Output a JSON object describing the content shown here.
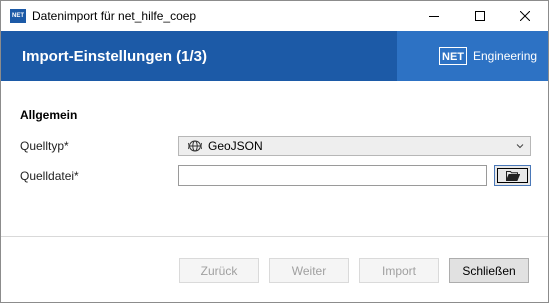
{
  "window": {
    "title": "Datenimport für net_hilfe_coep",
    "app_icon_text": "NET"
  },
  "header": {
    "title": "Import-Einstellungen (1/3)",
    "logo_mark": "NET",
    "logo_text": "Engineering"
  },
  "form": {
    "section_title": "Allgemein",
    "source_type": {
      "label": "Quelltyp*",
      "value": "GeoJSON",
      "icon": "globe-icon"
    },
    "source_file": {
      "label": "Quelldatei*",
      "value": "",
      "browse_icon": "folder-open-icon"
    }
  },
  "footer": {
    "back_label": "Zurück",
    "next_label": "Weiter",
    "import_label": "Import",
    "close_label": "Schließen"
  },
  "colors": {
    "banner": "#1c5aa7",
    "banner_logo_bg": "#2d72c4"
  }
}
